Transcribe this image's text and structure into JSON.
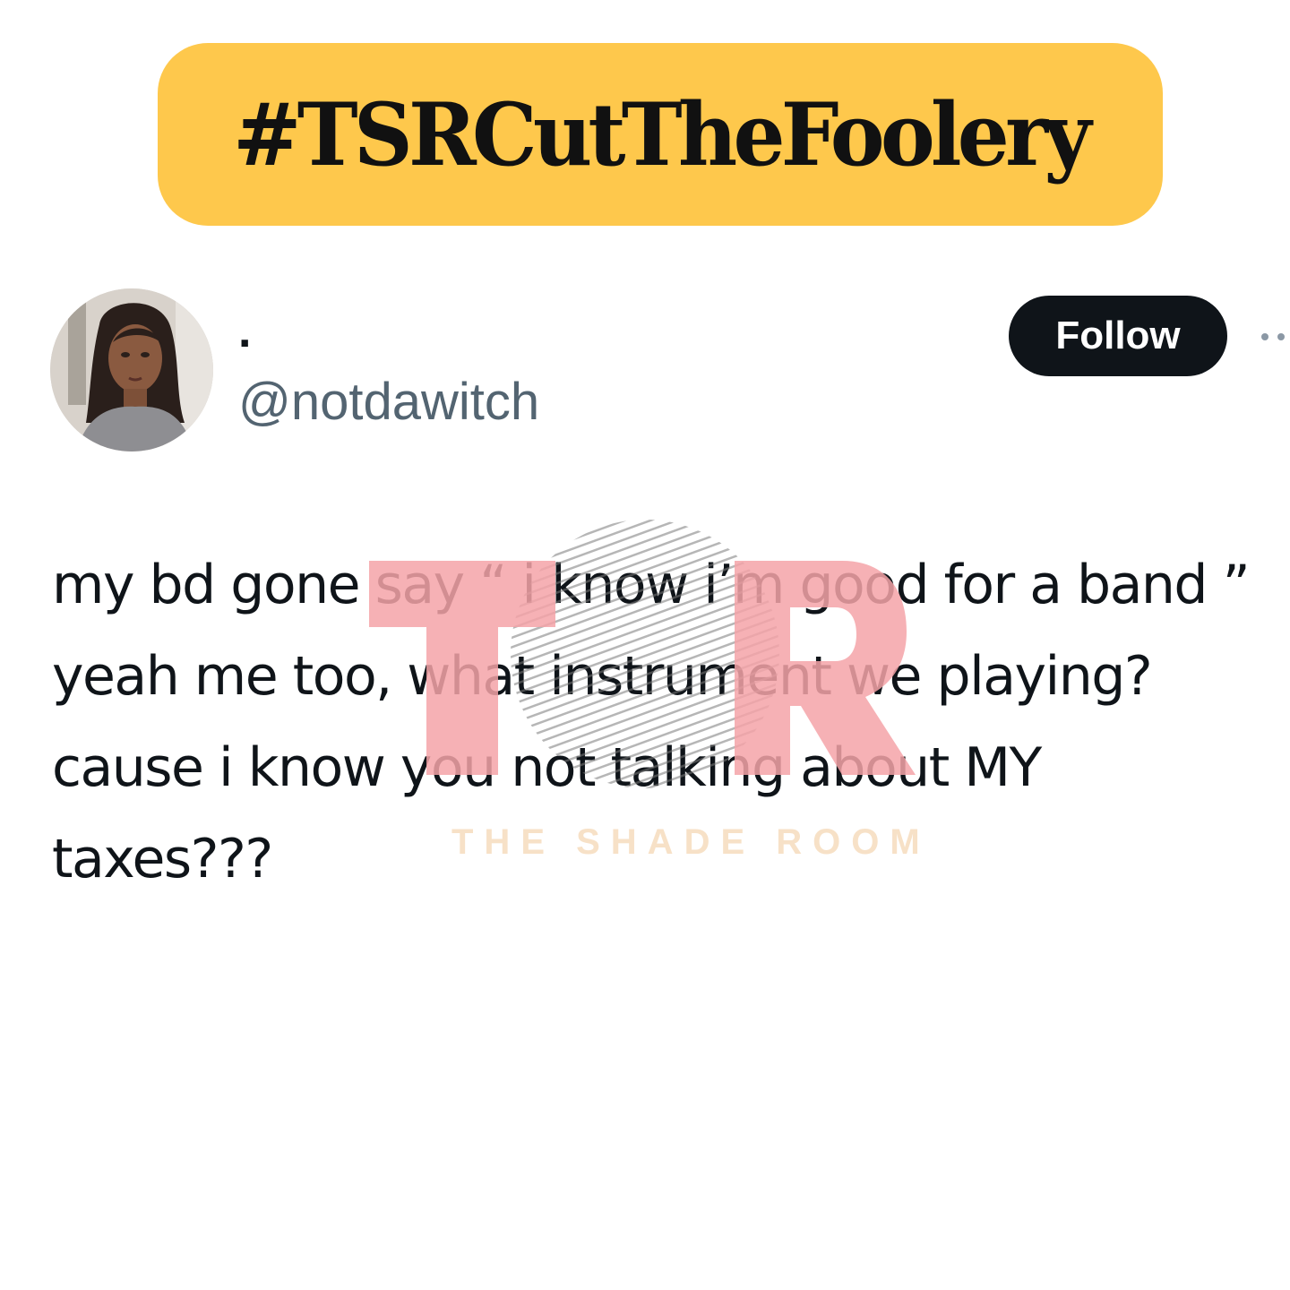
{
  "banner": {
    "hashtag": "#TSRCutTheFoolery",
    "background_color": "#fec84c"
  },
  "tweet": {
    "display_name": ".",
    "handle": "@notdawitch",
    "follow_label": "Follow",
    "more_icon": "more-dots-icon",
    "text_lines": [
      "my bd gone say “ i know i’m good for a band ”",
      "yeah me too, what instrument we playing?",
      "cause i know you not talking about MY",
      "taxes???"
    ]
  },
  "watermark": {
    "logo_letters": "TSR",
    "caption": "THE SHADE ROOM",
    "letter_color": "#f4a3a8",
    "caption_color": "#f7e1c7"
  }
}
